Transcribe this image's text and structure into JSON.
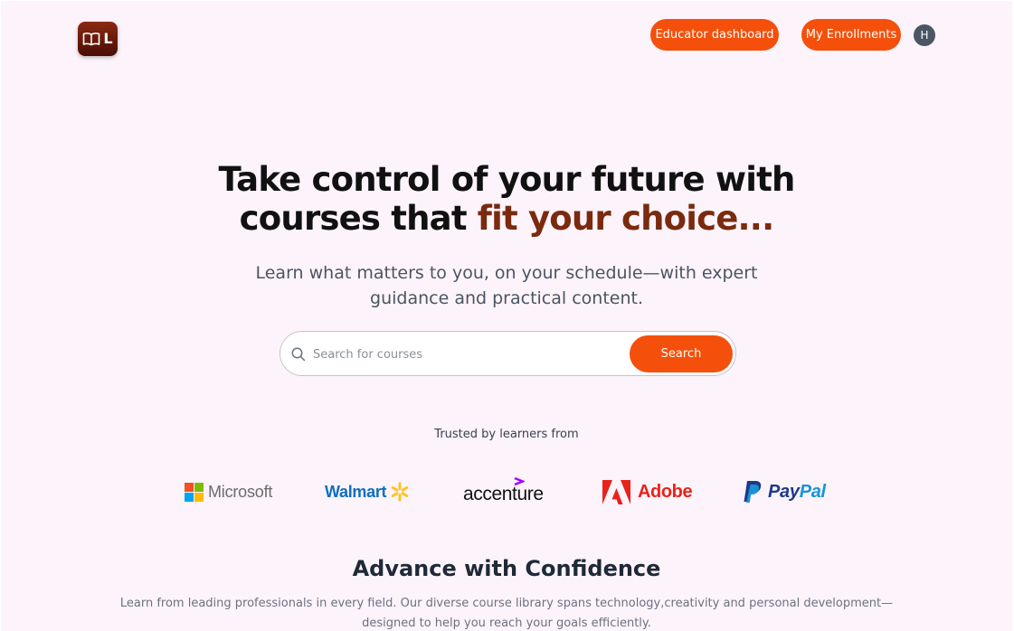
{
  "header": {
    "logo_letter": "L",
    "educator_button": "Educator dashboard",
    "enrollments_button": "My Enrollments",
    "avatar_initial": "H"
  },
  "hero": {
    "title_line1": "Take control of your future with",
    "title_line2_plain": "courses that ",
    "title_line2_accent": "fit your choice...",
    "subtitle_line1": "Learn what matters to you, on your schedule—with expert",
    "subtitle_line2": "guidance and practical content."
  },
  "search": {
    "placeholder": "Search for courses",
    "value": "",
    "button_label": "Search"
  },
  "trusted": {
    "label": "Trusted by learners from",
    "brands": [
      {
        "name": "Microsoft",
        "icon": "microsoft-logo-icon"
      },
      {
        "name": "Walmart",
        "icon": "walmart-spark-icon"
      },
      {
        "name": "accenture",
        "icon": "accenture-caret-icon"
      },
      {
        "name": "Adobe",
        "icon": "adobe-logo-icon"
      },
      {
        "name": "PayPal",
        "icon": "paypal-logo-icon",
        "parts": [
          "Pay",
          "Pal"
        ]
      }
    ]
  },
  "advance": {
    "title": "Advance with Confidence",
    "text_line1": "Learn from leading professionals in every field. Our diverse course library spans technology,creativity and personal development—",
    "text_line2": "designed to help you reach your goals efficiently."
  },
  "colors": {
    "accent": "#f4500b",
    "title_accent": "#7a2a0e",
    "background": "#fdf3fb",
    "avatar": "#4b5563"
  }
}
